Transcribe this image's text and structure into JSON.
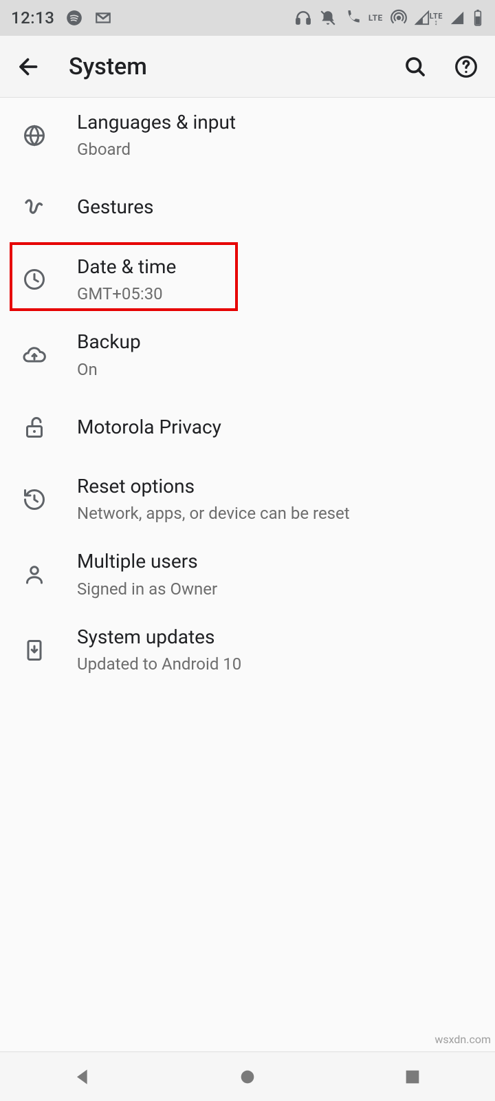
{
  "status": {
    "time": "12:13",
    "icons_left": [
      "spotify",
      "gmail"
    ],
    "icons_right": [
      "headphones",
      "dnd-off",
      "volte",
      "hotspot",
      "signal-lte",
      "signal",
      "battery"
    ]
  },
  "appbar": {
    "title": "System",
    "back": "Back",
    "search": "Search",
    "help": "Help"
  },
  "settings": [
    {
      "id": "languages",
      "title": "Languages & input",
      "subtitle": "Gboard",
      "icon": "globe"
    },
    {
      "id": "gestures",
      "title": "Gestures",
      "subtitle": "",
      "icon": "gesture"
    },
    {
      "id": "datetime",
      "title": "Date & time",
      "subtitle": "GMT+05:30",
      "icon": "clock",
      "highlighted": true
    },
    {
      "id": "backup",
      "title": "Backup",
      "subtitle": "On",
      "icon": "cloud-up"
    },
    {
      "id": "privacy",
      "title": "Motorola Privacy",
      "subtitle": "",
      "icon": "unlock"
    },
    {
      "id": "reset",
      "title": "Reset options",
      "subtitle": "Network, apps, or device can be reset",
      "icon": "history"
    },
    {
      "id": "users",
      "title": "Multiple users",
      "subtitle": "Signed in as Owner",
      "icon": "person"
    },
    {
      "id": "updates",
      "title": "System updates",
      "subtitle": "Updated to Android 10",
      "icon": "phone-update"
    }
  ],
  "nav": {
    "back": "Back",
    "home": "Home",
    "recents": "Recents"
  },
  "watermark": "wsxdn.com"
}
